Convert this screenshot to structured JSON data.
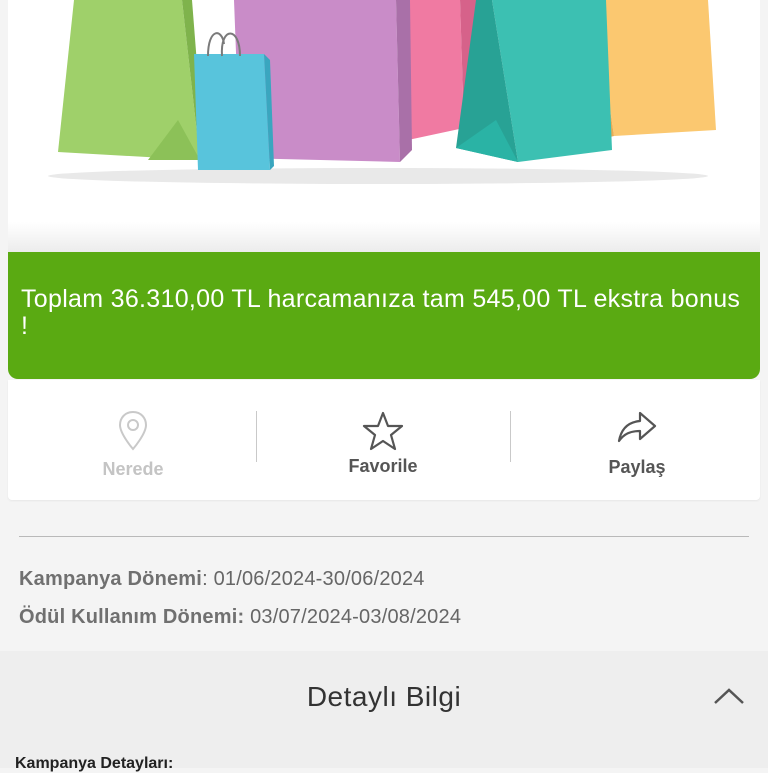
{
  "banner": {
    "text": "Toplam 36.310,00 TL harcamanıza tam 545,00 TL ekstra bonus !",
    "color": "#5aaa12"
  },
  "actions": [
    {
      "label": "Nerede",
      "icon": "location-pin-icon",
      "enabled": false
    },
    {
      "label": "Favorile",
      "icon": "star-icon",
      "enabled": true
    },
    {
      "label": "Paylaş",
      "icon": "share-arrow-icon",
      "enabled": true
    }
  ],
  "campaign": {
    "period_label": "Kampanya Dönemi",
    "period_value": ": 01/06/2024-30/06/2024",
    "reward_label": "Ödül Kullanım Dönemi:",
    "reward_value": " 03/07/2024-03/08/2024"
  },
  "details": {
    "title": "Detaylı Bilgi",
    "toggle_icon": "chevron-up-icon",
    "subtitle": "Kampanya Detayları:"
  },
  "hero": {
    "image": "shopping-bags-illustration",
    "bag_colors": [
      "#9fd06a",
      "#58c4dc",
      "#c98cc8",
      "#f07aa2",
      "#3cc0b2",
      "#fbc870"
    ]
  }
}
